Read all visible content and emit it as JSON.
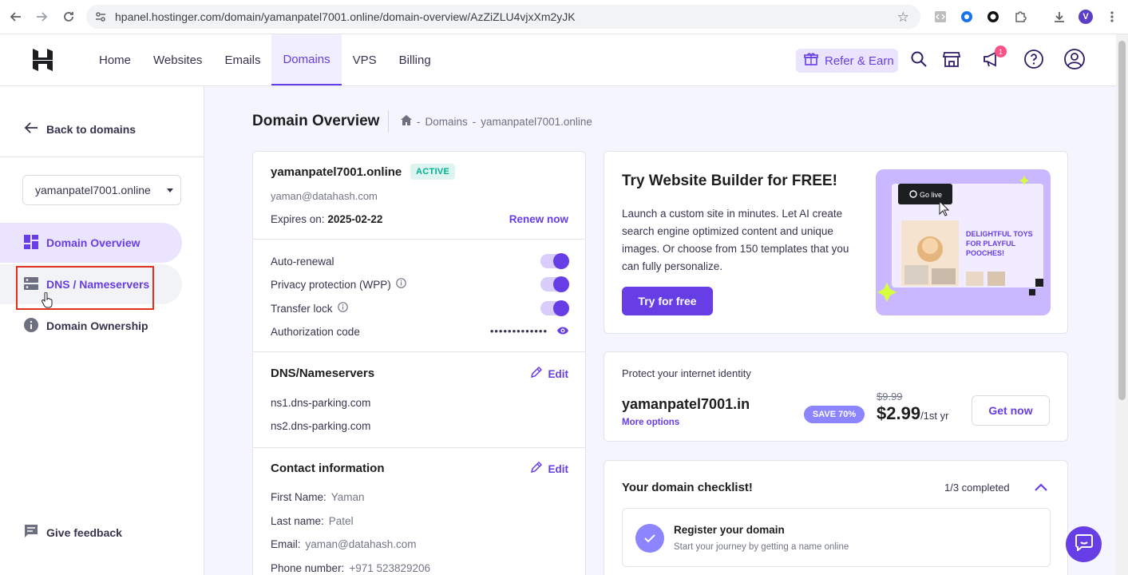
{
  "browser": {
    "url": "hpanel.hostinger.com/domain/yamanpatel7001.online/domain-overview/AzZiZLU4vjxXm2yJK",
    "profile_initial": "V"
  },
  "header": {
    "nav": [
      "Home",
      "Websites",
      "Emails",
      "Domains",
      "VPS",
      "Billing"
    ],
    "active_nav": "Domains",
    "refer_label": "Refer & Earn",
    "notification_count": "1"
  },
  "sidebar": {
    "back_label": "Back to domains",
    "selected_domain": "yamanpatel7001.online",
    "items": [
      {
        "label": "Domain Overview",
        "state": "active"
      },
      {
        "label": "DNS / Nameservers",
        "state": "hover"
      },
      {
        "label": "Domain Ownership",
        "state": "normal"
      }
    ],
    "feedback_label": "Give feedback"
  },
  "page": {
    "title": "Domain Overview",
    "breadcrumb": [
      "Domains",
      "yamanpatel7001.online"
    ]
  },
  "domain_card": {
    "name": "yamanpatel7001.online",
    "status": "ACTIVE",
    "email": "yaman@datahash.com",
    "expires_label": "Expires on:",
    "expires_date": "2025-02-22",
    "renew_label": "Renew now",
    "settings": [
      {
        "label": "Auto-renewal",
        "enabled": true,
        "info": false
      },
      {
        "label": "Privacy protection (WPP)",
        "enabled": true,
        "info": true
      },
      {
        "label": "Transfer lock",
        "enabled": true,
        "info": true
      }
    ],
    "auth_label": "Authorization code",
    "auth_value": "•••••••••••••",
    "dns_title": "DNS/Nameservers",
    "edit_label": "Edit",
    "nameservers": [
      "ns1.dns-parking.com",
      "ns2.dns-parking.com"
    ],
    "contact_title": "Contact information",
    "contact": [
      {
        "label": "First Name:",
        "value": "Yaman"
      },
      {
        "label": "Last name:",
        "value": "Patel"
      },
      {
        "label": "Email:",
        "value": "yaman@datahash.com"
      },
      {
        "label": "Phone number:",
        "value": "+971 523829206"
      }
    ]
  },
  "builder": {
    "title": "Try Website Builder for FREE!",
    "description": "Launch a custom site in minutes. Let AI create search engine optimized content and unique images. Or choose from 150 templates that you can fully personalize.",
    "button": "Try for free",
    "illus_go_live": "Go live",
    "illus_headline": "DELIGHTFUL TOYS FOR PLAYFUL POOCHES!"
  },
  "offer": {
    "label": "Protect your internet identity",
    "domain": "yamanpatel7001.in",
    "more": "More options",
    "save": "SAVE 70%",
    "old_price": "$9.99",
    "new_price": "$2.99",
    "period": "/1st yr",
    "button": "Get now"
  },
  "checklist": {
    "title": "Your domain checklist!",
    "progress": "1/3 completed",
    "item_title": "Register your domain",
    "item_sub": "Start your journey by getting a name online"
  }
}
